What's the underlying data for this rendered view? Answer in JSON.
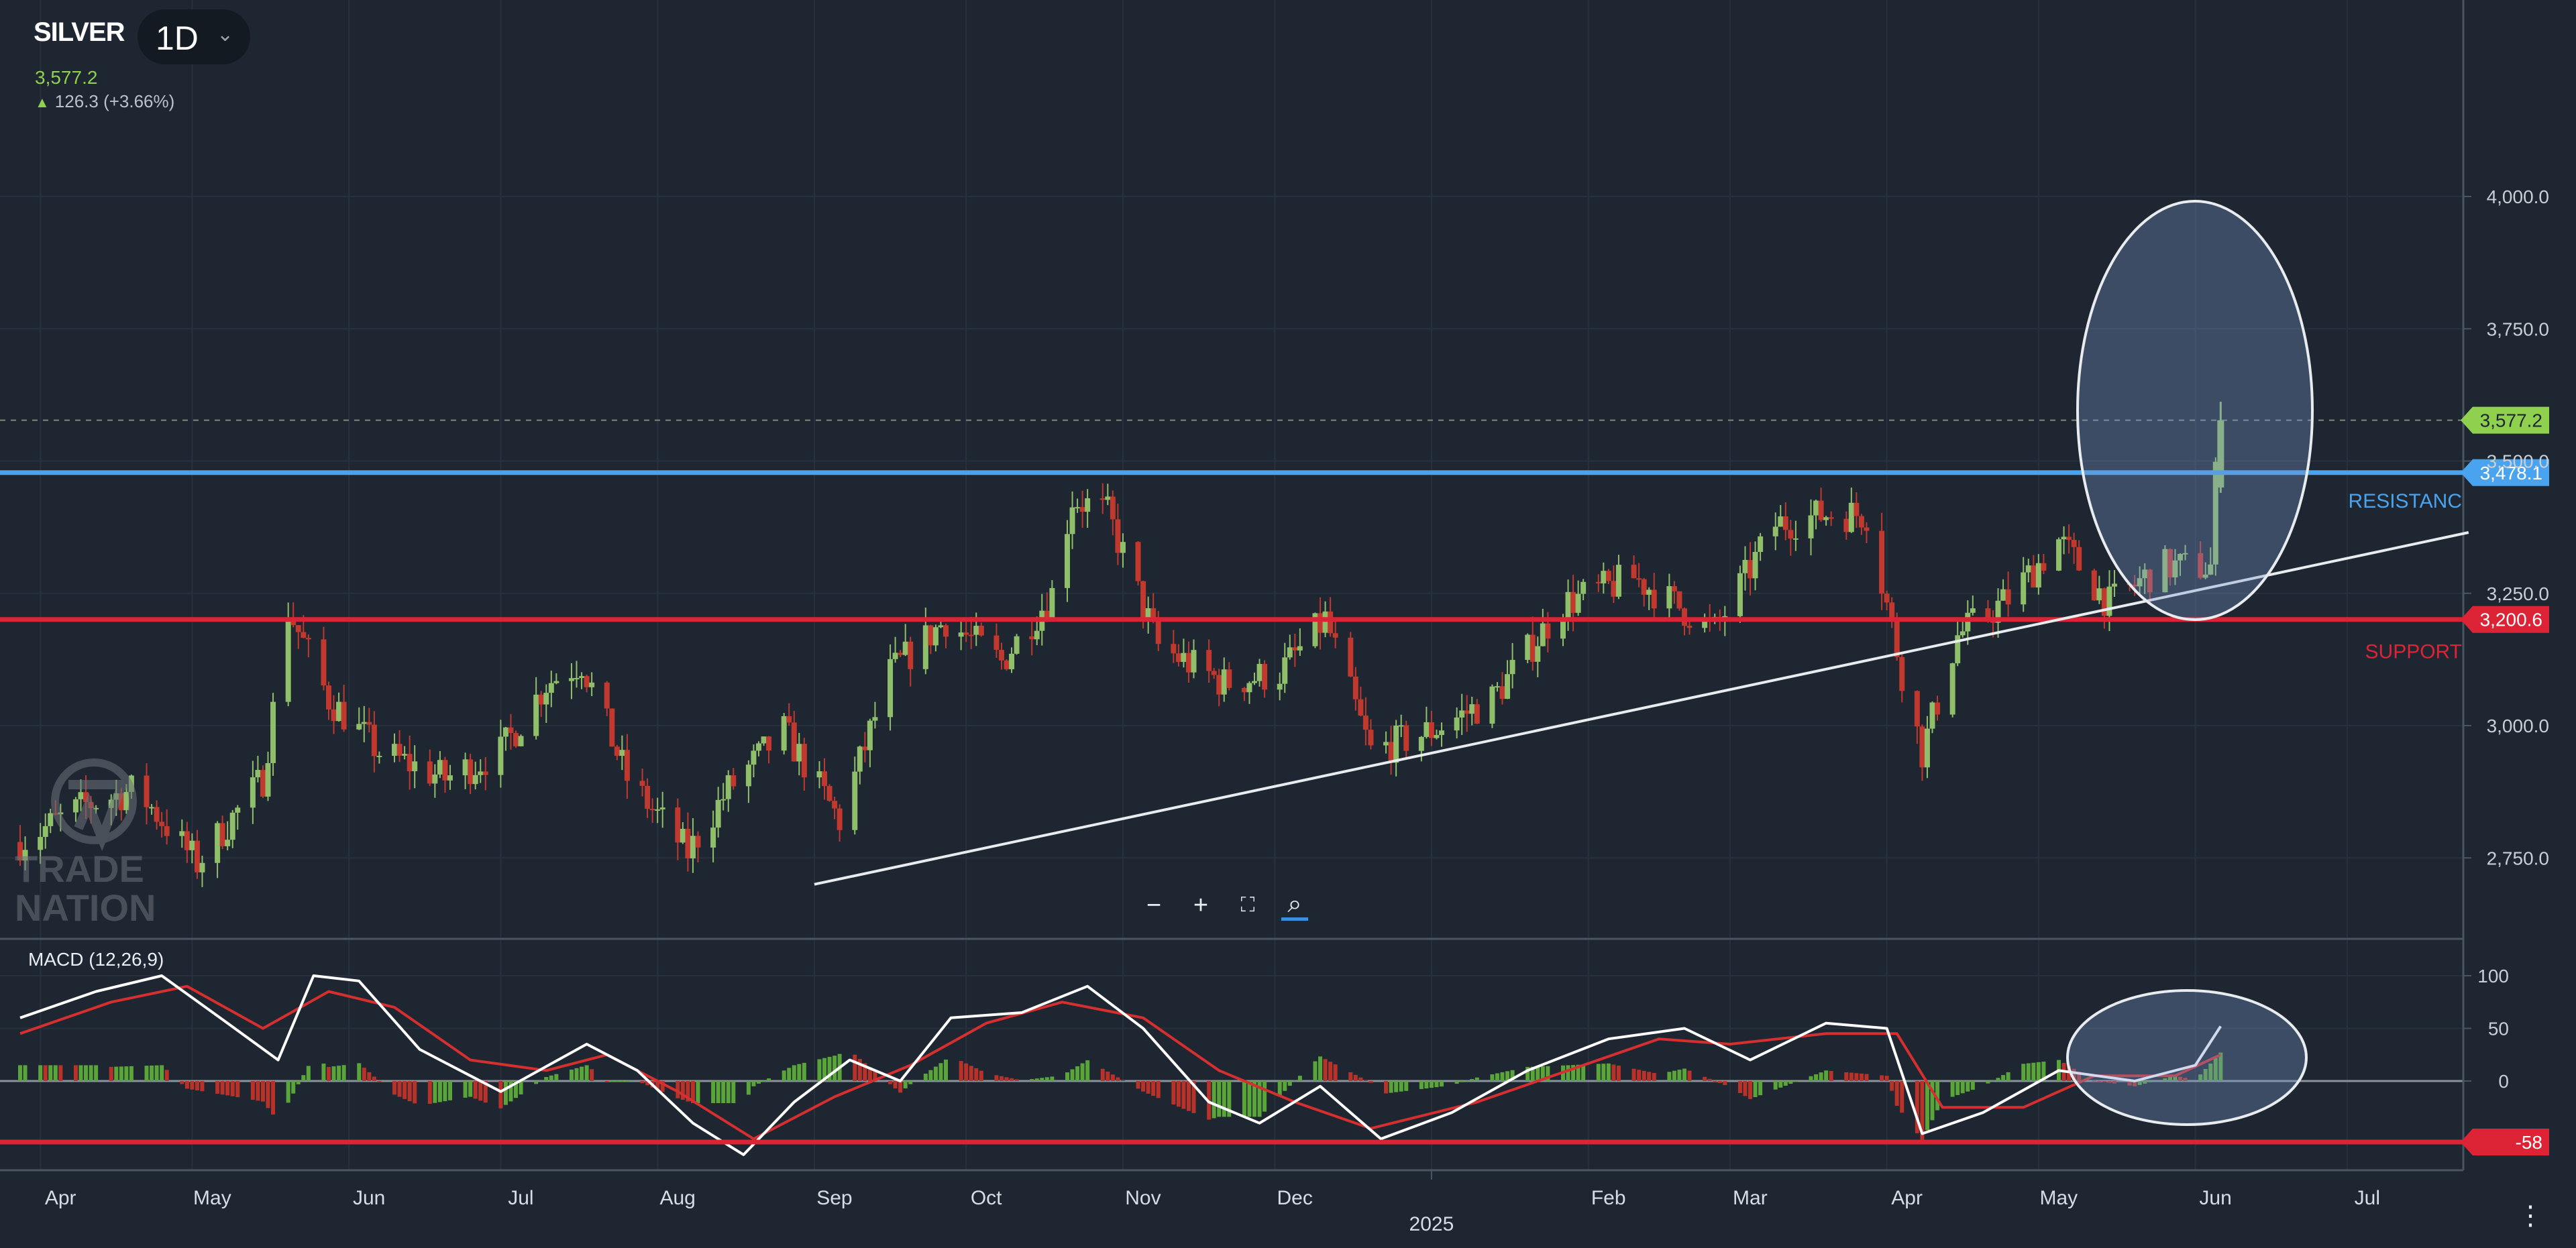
{
  "header": {
    "symbol": "SILVER",
    "timeframe": "1D",
    "last_price": "3,577.2",
    "change": "126.3 (+3.66%)"
  },
  "colors": {
    "background": "#1e2631",
    "up": "#8fbf6a",
    "down": "#c0382e",
    "resistance": "#4aa3ee",
    "support": "#dc2436",
    "trendline": "#e8ecef",
    "last_price": "#8fd14f",
    "macd_line": "#ffffff",
    "signal_line": "#d52f2f"
  },
  "levels": {
    "resistance": {
      "label": "RESISTANC",
      "value": 3478.1,
      "tag": "3,478.1"
    },
    "support": {
      "label": "SUPPORT",
      "value": 3200.6,
      "tag": "3,200.6"
    },
    "last": {
      "value": 3577.2,
      "tag": "3,577.2"
    },
    "macd_level": {
      "value": -58,
      "tag": "-58"
    }
  },
  "zoom_controls": [
    "−",
    "+",
    "⛶",
    "⌕"
  ],
  "macd": {
    "title": "MACD (12,26,9)"
  },
  "logo_text": "TRADE NATION",
  "chart_data": [
    {
      "type": "candlestick",
      "title": "SILVER",
      "y_ticks": [
        "2,750.0",
        "3,000.0",
        "3,250.0",
        "3,500.0",
        "3,750.0",
        "4,000.0"
      ],
      "ylim": [
        2700,
        4010
      ],
      "x_ticks": [
        "Apr",
        "May",
        "Jun",
        "Jul",
        "Aug",
        "Sep",
        "Oct",
        "Nov",
        "Dec",
        "2025",
        "Feb",
        "Mar",
        "Apr",
        "May",
        "Jun",
        "Jul"
      ],
      "x_ticks_sub": "2025",
      "grid": true,
      "trendline": {
        "from": {
          "date": "2024-09-01",
          "price": 2700
        },
        "to": {
          "date": "2025-07-25",
          "price": 3365
        }
      },
      "close_path": [
        {
          "date": "2024-03-28",
          "close": 2780
        },
        {
          "date": "2024-04-10",
          "close": 2850
        },
        {
          "date": "2024-04-20",
          "close": 2880
        },
        {
          "date": "2024-05-02",
          "close": 2740
        },
        {
          "date": "2024-05-15",
          "close": 2900
        },
        {
          "date": "2024-05-20",
          "close": 3220
        },
        {
          "date": "2024-05-28",
          "close": 3050
        },
        {
          "date": "2024-06-07",
          "close": 2950
        },
        {
          "date": "2024-06-20",
          "close": 2900
        },
        {
          "date": "2024-07-01",
          "close": 2950
        },
        {
          "date": "2024-07-10",
          "close": 3080
        },
        {
          "date": "2024-07-17",
          "close": 3120
        },
        {
          "date": "2024-07-26",
          "close": 2900
        },
        {
          "date": "2024-08-07",
          "close": 2760
        },
        {
          "date": "2024-08-15",
          "close": 2880
        },
        {
          "date": "2024-08-26",
          "close": 2990
        },
        {
          "date": "2024-09-06",
          "close": 2820
        },
        {
          "date": "2024-09-16",
          "close": 3100
        },
        {
          "date": "2024-09-27",
          "close": 3200
        },
        {
          "date": "2024-10-08",
          "close": 3120
        },
        {
          "date": "2024-10-18",
          "close": 3250
        },
        {
          "date": "2024-10-22",
          "close": 3430
        },
        {
          "date": "2024-10-29",
          "close": 3400
        },
        {
          "date": "2024-11-08",
          "close": 3150
        },
        {
          "date": "2024-11-21",
          "close": 3080
        },
        {
          "date": "2024-12-02",
          "close": 3100
        },
        {
          "date": "2024-12-11",
          "close": 3200
        },
        {
          "date": "2024-12-20",
          "close": 2950
        },
        {
          "date": "2025-01-01",
          "close": 2990
        },
        {
          "date": "2025-01-13",
          "close": 3050
        },
        {
          "date": "2025-01-27",
          "close": 3230
        },
        {
          "date": "2025-02-10",
          "close": 3280
        },
        {
          "date": "2025-02-26",
          "close": 3180
        },
        {
          "date": "2025-03-10",
          "close": 3380
        },
        {
          "date": "2025-03-20",
          "close": 3400
        },
        {
          "date": "2025-03-28",
          "close": 3400
        },
        {
          "date": "2025-04-04",
          "close": 3100
        },
        {
          "date": "2025-04-08",
          "close": 2950
        },
        {
          "date": "2025-04-15",
          "close": 3170
        },
        {
          "date": "2025-04-25",
          "close": 3240
        },
        {
          "date": "2025-05-05",
          "close": 3350
        },
        {
          "date": "2025-05-15",
          "close": 3230
        },
        {
          "date": "2025-05-25",
          "close": 3300
        },
        {
          "date": "2025-06-04",
          "close": 3300
        },
        {
          "date": "2025-06-05",
          "close": 3470
        },
        {
          "date": "2025-06-06",
          "close": 3577.2
        }
      ],
      "swing_extremes": [
        {
          "date": "2024-10-22",
          "high": 3470
        },
        {
          "date": "2025-03-28",
          "high": 3450
        },
        {
          "date": "2025-04-08",
          "low": 2830
        },
        {
          "date": "2025-06-06",
          "high": 3610
        }
      ]
    },
    {
      "type": "line",
      "title": "MACD (12,26,9)",
      "y_ticks": [
        "100",
        "50",
        "0"
      ],
      "ylim": [
        -80,
        110
      ],
      "series": [
        {
          "values": [
            {
              "date": "2024-03-28",
              "v": 60
            },
            {
              "date": "2024-04-12",
              "v": 85
            },
            {
              "date": "2024-04-25",
              "v": 100
            },
            {
              "date": "2024-05-08",
              "v": 55
            },
            {
              "date": "2024-05-18",
              "v": 20
            },
            {
              "date": "2024-05-25",
              "v": 100
            },
            {
              "date": "2024-06-03",
              "v": 95
            },
            {
              "date": "2024-06-15",
              "v": 30
            },
            {
              "date": "2024-07-01",
              "v": -10
            },
            {
              "date": "2024-07-18",
              "v": 35
            },
            {
              "date": "2024-07-28",
              "v": 10
            },
            {
              "date": "2024-08-08",
              "v": -40
            },
            {
              "date": "2024-08-18",
              "v": -70
            },
            {
              "date": "2024-08-28",
              "v": -20
            },
            {
              "date": "2024-09-08",
              "v": 20
            },
            {
              "date": "2024-09-18",
              "v": 0
            },
            {
              "date": "2024-09-28",
              "v": 60
            },
            {
              "date": "2024-10-12",
              "v": 65
            },
            {
              "date": "2024-10-25",
              "v": 90
            },
            {
              "date": "2024-11-05",
              "v": 50
            },
            {
              "date": "2024-11-18",
              "v": -20
            },
            {
              "date": "2024-11-28",
              "v": -40
            },
            {
              "date": "2024-12-10",
              "v": -5
            },
            {
              "date": "2024-12-22",
              "v": -55
            },
            {
              "date": "2025-01-05",
              "v": -30
            },
            {
              "date": "2025-01-20",
              "v": 10
            },
            {
              "date": "2025-02-05",
              "v": 40
            },
            {
              "date": "2025-02-20",
              "v": 50
            },
            {
              "date": "2025-03-05",
              "v": 20
            },
            {
              "date": "2025-03-20",
              "v": 55
            },
            {
              "date": "2025-04-01",
              "v": 50
            },
            {
              "date": "2025-04-08",
              "v": -50
            },
            {
              "date": "2025-04-20",
              "v": -30
            },
            {
              "date": "2025-05-05",
              "v": 10
            },
            {
              "date": "2025-05-20",
              "v": 0
            },
            {
              "date": "2025-06-01",
              "v": 15
            },
            {
              "date": "2025-06-06",
              "v": 52
            }
          ]
        },
        {
          "values": [
            {
              "date": "2024-03-28",
              "v": 45
            },
            {
              "date": "2024-04-15",
              "v": 75
            },
            {
              "date": "2024-04-30",
              "v": 90
            },
            {
              "date": "2024-05-15",
              "v": 50
            },
            {
              "date": "2024-05-28",
              "v": 85
            },
            {
              "date": "2024-06-10",
              "v": 70
            },
            {
              "date": "2024-06-25",
              "v": 20
            },
            {
              "date": "2024-07-10",
              "v": 10
            },
            {
              "date": "2024-07-22",
              "v": 25
            },
            {
              "date": "2024-08-05",
              "v": -10
            },
            {
              "date": "2024-08-20",
              "v": -55
            },
            {
              "date": "2024-09-05",
              "v": -15
            },
            {
              "date": "2024-09-20",
              "v": 15
            },
            {
              "date": "2024-10-05",
              "v": 55
            },
            {
              "date": "2024-10-20",
              "v": 75
            },
            {
              "date": "2024-11-05",
              "v": 60
            },
            {
              "date": "2024-11-20",
              "v": 10
            },
            {
              "date": "2024-12-05",
              "v": -20
            },
            {
              "date": "2024-12-20",
              "v": -45
            },
            {
              "date": "2025-01-10",
              "v": -20
            },
            {
              "date": "2025-01-28",
              "v": 10
            },
            {
              "date": "2025-02-15",
              "v": 40
            },
            {
              "date": "2025-03-01",
              "v": 35
            },
            {
              "date": "2025-03-20",
              "v": 45
            },
            {
              "date": "2025-04-03",
              "v": 45
            },
            {
              "date": "2025-04-12",
              "v": -25
            },
            {
              "date": "2025-04-28",
              "v": -25
            },
            {
              "date": "2025-05-12",
              "v": 5
            },
            {
              "date": "2025-05-28",
              "v": 5
            },
            {
              "date": "2025-06-06",
              "v": 25
            }
          ]
        }
      ]
    }
  ]
}
